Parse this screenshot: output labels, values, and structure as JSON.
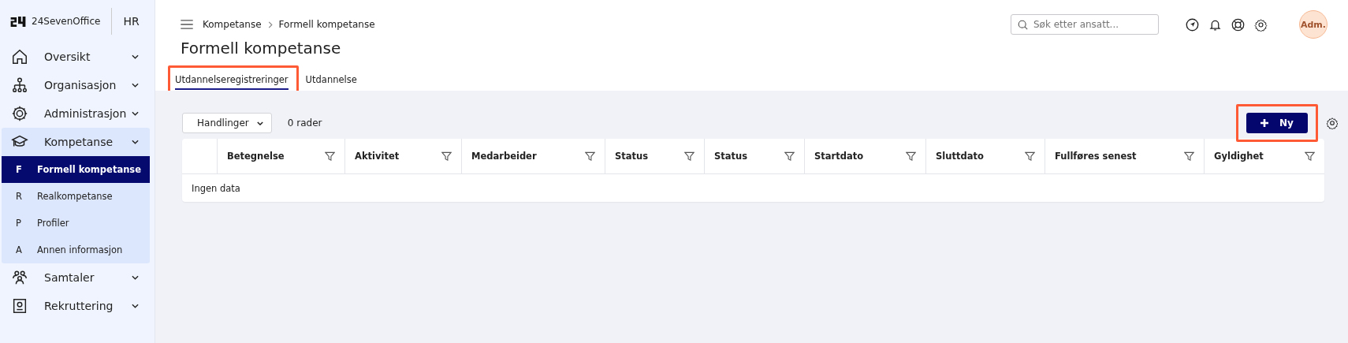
{
  "brand": {
    "name": "24SevenOffice",
    "module": "HR"
  },
  "sidebar": {
    "items": [
      {
        "label": "Oversikt",
        "expanded": false
      },
      {
        "label": "Organisasjon",
        "expanded": false
      },
      {
        "label": "Administrasjon",
        "expanded": false
      },
      {
        "label": "Kompetanse",
        "expanded": true,
        "children": [
          {
            "letter": "F",
            "label": "Formell kompetanse",
            "selected": true
          },
          {
            "letter": "R",
            "label": "Realkompetanse",
            "selected": false
          },
          {
            "letter": "P",
            "label": "Profiler",
            "selected": false
          },
          {
            "letter": "A",
            "label": "Annen informasjon",
            "selected": false
          }
        ]
      },
      {
        "label": "Samtaler",
        "expanded": false
      },
      {
        "label": "Rekruttering",
        "expanded": false
      }
    ]
  },
  "breadcrumb": [
    "Kompetanse",
    "Formell kompetanse"
  ],
  "search": {
    "placeholder": "Søk etter ansatt..."
  },
  "avatar": "Adm.",
  "page_title": "Formell kompetanse",
  "tabs": [
    {
      "label": "Utdannelseregistreringer",
      "selected": true,
      "highlighted": true
    },
    {
      "label": "Utdannelse",
      "selected": false,
      "highlighted": false
    }
  ],
  "toolbar": {
    "actions": "Handlinger",
    "row_count": "0 rader",
    "new_button": {
      "label": "Ny",
      "highlighted": true
    }
  },
  "table": {
    "columns": [
      "Betegnelse",
      "Aktivitet",
      "Medarbeider",
      "Status",
      "Status",
      "Startdato",
      "Sluttdato",
      "Fullføres senest",
      "Gyldighet"
    ],
    "empty_text": "Ingen data"
  }
}
